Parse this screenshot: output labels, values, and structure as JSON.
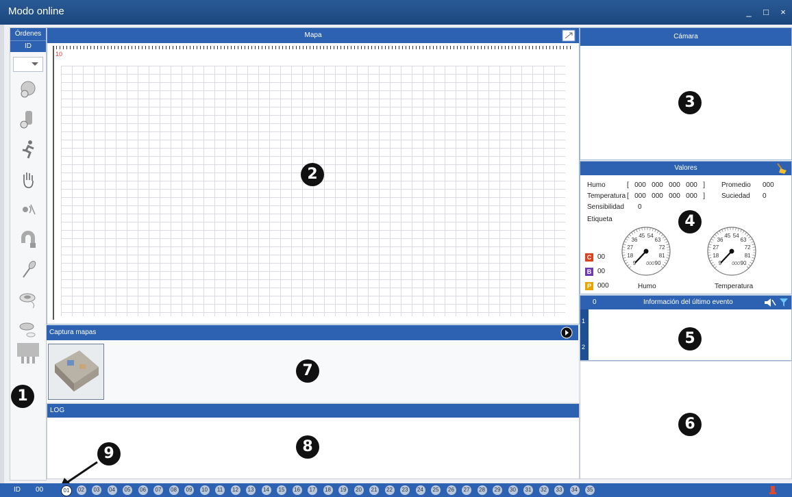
{
  "window": {
    "title": "Modo online",
    "min": "_",
    "max": "□",
    "close": "×"
  },
  "orders": {
    "header": "Órdenes",
    "id_label": "ID"
  },
  "map": {
    "title": "Mapa",
    "scale_label": "10"
  },
  "camera": {
    "title": "Cámara"
  },
  "values": {
    "title": "Valores",
    "humo_label": "Humo",
    "humo_values": "[   000   000   000   000   ]",
    "temp_label": "Temperatura",
    "temp_values": "[   000   000   000   000   ]",
    "promedio_label": "Promedio",
    "promedio_value": "000",
    "suciedad_label": "Suciedad",
    "suciedad_value": "0",
    "sens_label": "Sensibilidad",
    "sens_value": "0",
    "etiqueta_label": "Etiqueta",
    "c_label": "C",
    "c_value": "00",
    "b_label": "B",
    "b_value": "00",
    "p_label": "P",
    "p_value": "000",
    "gauge_humo_label": "Humo",
    "gauge_temp_label": "Temperatura",
    "gauge_ticks": [
      "9",
      "18",
      "27",
      "36",
      "45",
      "54",
      "63",
      "72",
      "81",
      "90"
    ],
    "gauge_readout": "000"
  },
  "event": {
    "count": "0",
    "title": "Información del último evento",
    "rows": [
      "1",
      "2"
    ]
  },
  "capture": {
    "title": "Captura mapas"
  },
  "log": {
    "title": "LOG"
  },
  "status": {
    "id_label": "ID",
    "id_value": "00",
    "channels": [
      "01",
      "02",
      "03",
      "04",
      "05",
      "06",
      "07",
      "08",
      "09",
      "10",
      "11",
      "12",
      "13",
      "14",
      "15",
      "16",
      "17",
      "18",
      "19",
      "20",
      "21",
      "22",
      "23",
      "24",
      "25",
      "26",
      "27",
      "28",
      "29",
      "30",
      "31",
      "32",
      "33",
      "34",
      "35"
    ],
    "selected_channel": "01"
  },
  "markers": [
    "1",
    "2",
    "3",
    "4",
    "5",
    "6",
    "7",
    "8",
    "9"
  ],
  "colors": {
    "accent": "#2d62b2",
    "c_badge": "#d9421c",
    "b_badge": "#6f3bb0",
    "p_badge": "#e8a400"
  }
}
